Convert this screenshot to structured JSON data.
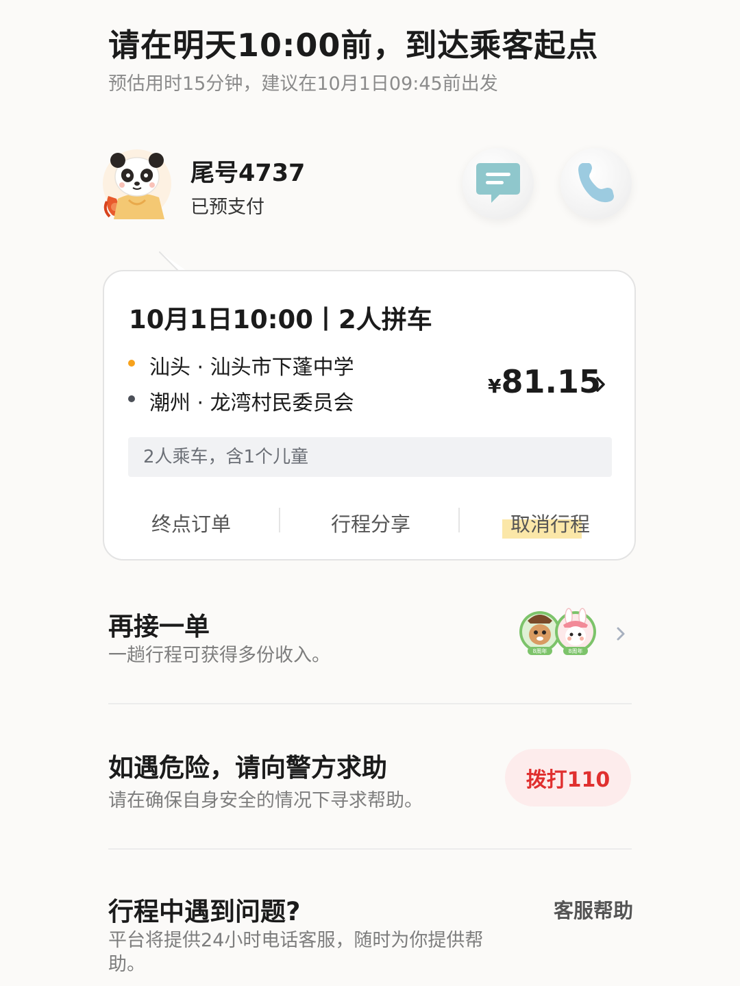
{
  "header": {
    "title": "请在明天10:00前，到达乘客起点",
    "subtitle": "预估用时15分钟，建议在10月1日09:45前出发"
  },
  "passenger": {
    "avatar_icon": "panda-avatar-icon",
    "tail_number": "尾号4737",
    "payment_status": "已预支付",
    "message_icon": "message-icon",
    "phone_icon": "phone-icon"
  },
  "trip": {
    "heading": "10月1日10:00丨2人拼车",
    "origin": "汕头 · 汕头市下蓬中学",
    "destination": "潮州 · 龙湾村民委员会",
    "currency": "¥",
    "price": "81.15",
    "passengers_note": "2人乘车，含1个儿童",
    "actions": [
      "终点订单",
      "行程分享",
      "取消行程"
    ],
    "colors": {
      "origin_dot": "#f7a21c",
      "destination_dot": "#4c5058"
    }
  },
  "another_order": {
    "title": "再接一单",
    "description": "一趟行程可获得多份收入。",
    "badge_text": [
      "8周年",
      "8周年"
    ]
  },
  "danger": {
    "title": "如遇危险，请向警方求助",
    "description": "请在确保自身安全的情况下寻求帮助。",
    "call_button": "拨打110",
    "call_color": "#e0302f"
  },
  "help": {
    "title": "行程中遇到问题?",
    "description": "平台将提供24小时电话客服，随时为你提供帮助。",
    "link": "客服帮助"
  }
}
